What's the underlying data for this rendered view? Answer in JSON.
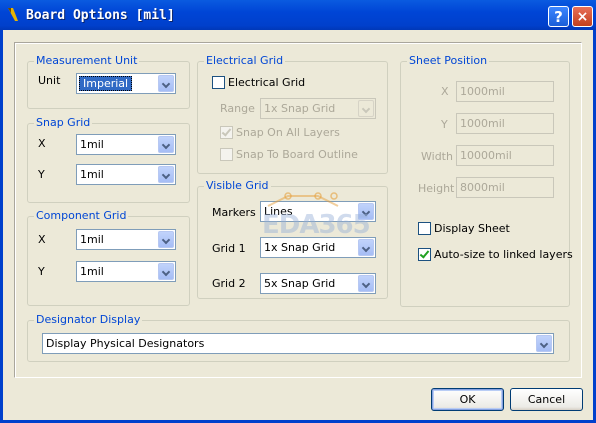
{
  "window": {
    "title": "Board Options [mil]",
    "help_label": "?",
    "close_label": "×"
  },
  "measurement": {
    "title": "Measurement Unit",
    "unit_label": "Unit",
    "unit_value": "Imperial"
  },
  "snap_grid": {
    "title": "Snap Grid",
    "x_label": "X",
    "x_value": "1mil",
    "y_label": "Y",
    "y_value": "1mil"
  },
  "component_grid": {
    "title": "Component Grid",
    "x_label": "X",
    "x_value": "1mil",
    "y_label": "Y",
    "y_value": "1mil"
  },
  "electrical_grid": {
    "title": "Electrical Grid",
    "enable_label": "Electrical Grid",
    "enable_checked": false,
    "range_label": "Range",
    "range_value": "1x Snap Grid",
    "snap_all_layers_label": "Snap On All Layers",
    "snap_all_layers_checked": true,
    "snap_board_outline_label": "Snap To Board Outline",
    "snap_board_outline_checked": false
  },
  "visible_grid": {
    "title": "Visible Grid",
    "markers_label": "Markers",
    "markers_value": "Lines",
    "grid1_label": "Grid 1",
    "grid1_value": "1x Snap Grid",
    "grid2_label": "Grid 2",
    "grid2_value": "5x Snap Grid"
  },
  "sheet_position": {
    "title": "Sheet Position",
    "x_label": "X",
    "x_value": "1000mil",
    "y_label": "Y",
    "y_value": "1000mil",
    "width_label": "Width",
    "width_value": "10000mil",
    "height_label": "Height",
    "height_value": "8000mil",
    "display_sheet_label": "Display Sheet",
    "display_sheet_checked": false,
    "auto_size_label": "Auto-size to linked layers",
    "auto_size_checked": true
  },
  "designator_display": {
    "title": "Designator Display",
    "value": "Display Physical Designators"
  },
  "footer": {
    "ok_label": "OK",
    "cancel_label": "Cancel"
  },
  "watermark": {
    "text": "EDA365"
  },
  "colors": {
    "titlebar": "#0045d6",
    "group_title": "#0046d5",
    "selection": "#316ac5",
    "dialog_bg": "#ece9d8"
  }
}
